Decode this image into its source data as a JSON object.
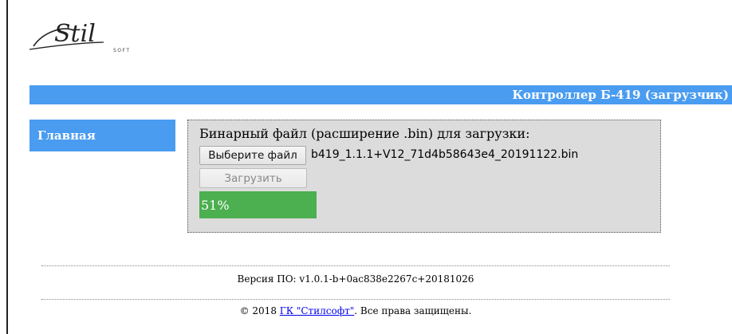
{
  "brand": {
    "logo_text": "Stil",
    "logo_subtext": "SOFT"
  },
  "header": {
    "title": "Контроллер Б-419 (загрузчик)"
  },
  "nav": {
    "main_label": "Главная"
  },
  "upload": {
    "prompt": "Бинарный файл (расширение .bin) для загрузки:",
    "choose_button_label": "Выберите файл",
    "file_name": "b419_1.1.1+V12_71d4b58643e4_20191122.bin",
    "upload_button_label": "Загрузить",
    "upload_button_enabled": false,
    "progress_value": 51,
    "progress_text": "51%"
  },
  "footer": {
    "version": "Версия ПО: v1.0.1-b+0ac838e2267c+20181026",
    "copyright_prefix": "© 2018 ",
    "company_link": "ГК \"Стилсофт\"",
    "copyright_suffix": ". Все права защищены."
  },
  "colors": {
    "accent": "#4a9cf0",
    "progress": "#4caf50",
    "panel_bg": "#dcdcdc",
    "link": "#0000ee"
  },
  "icons": {
    "logo": "stilsoft-logo"
  }
}
